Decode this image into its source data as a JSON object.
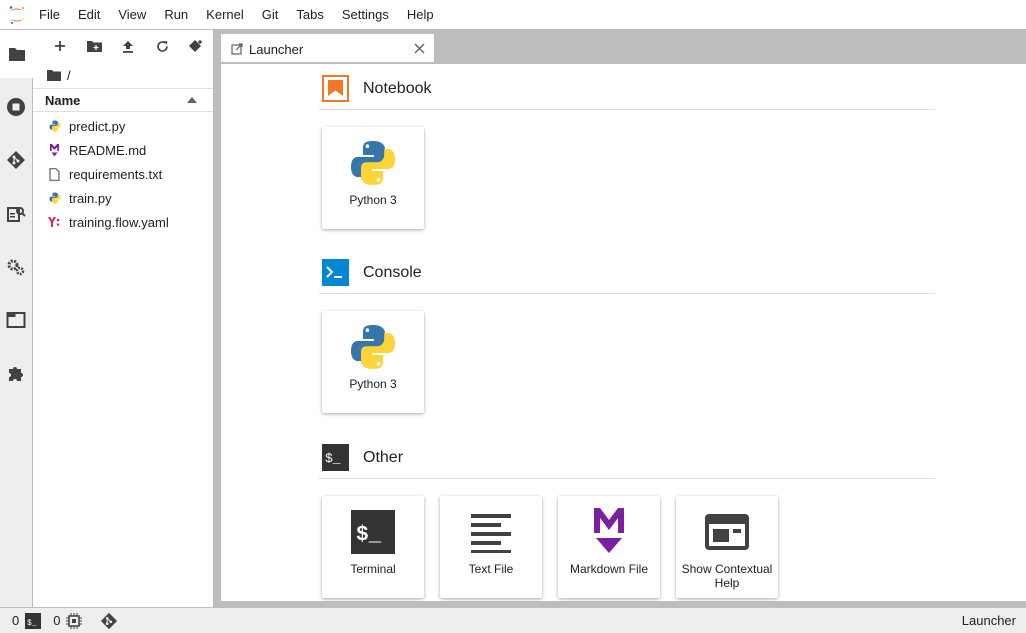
{
  "menu": {
    "items": [
      "File",
      "Edit",
      "View",
      "Run",
      "Kernel",
      "Git",
      "Tabs",
      "Settings",
      "Help"
    ]
  },
  "file_browser": {
    "breadcrumb": "/",
    "column_header": "Name",
    "files": [
      {
        "name": "predict.py",
        "icon": "python-file-icon"
      },
      {
        "name": "README.md",
        "icon": "markdown-file-icon"
      },
      {
        "name": "requirements.txt",
        "icon": "text-file-icon"
      },
      {
        "name": "train.py",
        "icon": "python-file-icon"
      },
      {
        "name": "training.flow.yaml",
        "icon": "yaml-file-icon"
      }
    ]
  },
  "tab": {
    "label": "Launcher"
  },
  "launcher": {
    "notebook": {
      "title": "Notebook",
      "cards": [
        {
          "label": "Python 3"
        }
      ]
    },
    "console": {
      "title": "Console",
      "cards": [
        {
          "label": "Python 3"
        }
      ]
    },
    "other": {
      "title": "Other",
      "cards": [
        {
          "label": "Terminal"
        },
        {
          "label": "Text File"
        },
        {
          "label": "Markdown File"
        },
        {
          "label": "Show Contextual Help"
        }
      ]
    }
  },
  "statusbar": {
    "kernels_count": "0",
    "terminals_count": "0",
    "right_label": "Launcher"
  },
  "colors": {
    "accent_orange": "#f37726",
    "console_blue": "#0d47a1",
    "markdown_purple": "#7b1fa2",
    "yaml_pink": "#e91e63",
    "python_blue": "#3776ab",
    "python_yellow": "#ffd43b"
  }
}
